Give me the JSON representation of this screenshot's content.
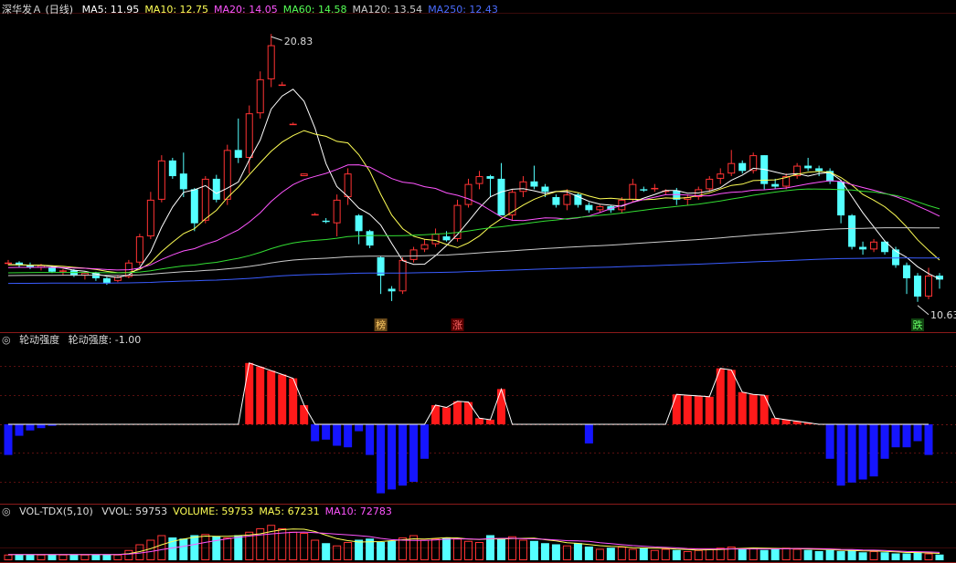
{
  "header_main": {
    "title": "深华发Ａ (日线)",
    "items": [
      {
        "label": "MA5: 11.95",
        "color": "#ffffff"
      },
      {
        "label": "MA10: 12.75",
        "color": "#ffff55"
      },
      {
        "label": "MA20: 14.05",
        "color": "#ff55ff"
      },
      {
        "label": "MA60: 14.58",
        "color": "#55ff55"
      },
      {
        "label": "MA120: 13.54",
        "color": "#cccccc"
      },
      {
        "label": "MA250: 12.43",
        "color": "#4a6cff"
      }
    ]
  },
  "header_ind": {
    "title": "轮动强度",
    "value": "轮动强度: -1.00"
  },
  "header_vol": {
    "title": "VOL-TDX(5,10)",
    "items": [
      {
        "label": "VVOL: 59753",
        "color": "#dddddd"
      },
      {
        "label": "VOLUME: 59753",
        "color": "#ffff55"
      },
      {
        "label": "MA5: 67231",
        "color": "#ffff55"
      },
      {
        "label": "MA10: 72783",
        "color": "#ff55ff"
      }
    ]
  },
  "annotations": {
    "high_label": "20.83",
    "low_label": "10.63",
    "tag_bang": "榜",
    "tag_zhang": "涨",
    "tag_die": "跌"
  },
  "colors": {
    "up": "#ff3333",
    "down": "#54ffff",
    "bar_pos": "#ff1a1a",
    "bar_neg": "#1515ff",
    "divider": "#8b1a1a"
  },
  "chart_data": [
    {
      "type": "candlestick",
      "title": "深华发Ａ (日线)",
      "y_range_estimated": [
        10.0,
        21.5
      ],
      "marked_high": 20.83,
      "marked_low": 10.63,
      "series_names": [
        "MA5",
        "MA10",
        "MA20",
        "MA60",
        "MA120",
        "MA250"
      ],
      "candles_ohlc": [
        [
          12.1,
          12.2,
          12.0,
          12.1
        ],
        [
          12.1,
          12.15,
          11.9,
          12.0
        ],
        [
          12.0,
          12.1,
          11.85,
          11.9
        ],
        [
          11.9,
          12.05,
          11.8,
          12.0
        ],
        [
          11.9,
          11.95,
          11.7,
          11.75
        ],
        [
          11.75,
          11.85,
          11.6,
          11.8
        ],
        [
          11.8,
          11.85,
          11.55,
          11.6
        ],
        [
          11.6,
          11.75,
          11.45,
          11.7
        ],
        [
          11.7,
          11.75,
          11.4,
          11.5
        ],
        [
          11.5,
          11.55,
          11.25,
          11.3
        ],
        [
          11.4,
          11.6,
          11.35,
          11.55
        ],
        [
          11.55,
          12.2,
          11.5,
          12.1
        ],
        [
          12.1,
          13.2,
          12.0,
          13.1
        ],
        [
          13.1,
          14.8,
          13.0,
          14.5
        ],
        [
          14.5,
          16.2,
          14.4,
          16.0
        ],
        [
          16.0,
          16.1,
          15.3,
          15.4
        ],
        [
          15.5,
          16.3,
          14.6,
          14.9
        ],
        [
          14.9,
          14.95,
          13.3,
          13.6
        ],
        [
          13.7,
          15.4,
          13.6,
          15.3
        ],
        [
          15.3,
          15.45,
          14.4,
          14.5
        ],
        [
          14.5,
          16.6,
          14.3,
          16.4
        ],
        [
          16.4,
          17.6,
          15.9,
          16.1
        ],
        [
          16.1,
          18.1,
          15.5,
          17.8
        ],
        [
          17.8,
          19.4,
          17.6,
          19.1
        ],
        [
          19.1,
          20.83,
          18.8,
          20.4
        ],
        [
          18.9,
          19.0,
          18.9,
          18.9
        ],
        [
          17.4,
          17.45,
          17.4,
          17.4
        ],
        [
          15.4,
          15.5,
          15.4,
          15.5
        ],
        [
          13.9,
          14.0,
          13.9,
          13.95
        ],
        [
          13.7,
          13.8,
          13.6,
          13.65
        ],
        [
          13.6,
          14.7,
          13.1,
          14.5
        ],
        [
          14.6,
          15.7,
          14.3,
          15.5
        ],
        [
          13.9,
          13.95,
          12.8,
          13.3
        ],
        [
          13.3,
          13.35,
          12.65,
          12.75
        ],
        [
          12.3,
          12.35,
          10.9,
          11.6
        ],
        [
          11.1,
          11.2,
          10.63,
          11.0
        ],
        [
          11.0,
          12.3,
          10.9,
          12.2
        ],
        [
          12.2,
          12.7,
          12.1,
          12.6
        ],
        [
          12.6,
          13.0,
          12.5,
          12.8
        ],
        [
          12.8,
          13.4,
          12.7,
          13.2
        ],
        [
          13.1,
          13.3,
          12.9,
          12.95
        ],
        [
          13.0,
          14.5,
          12.9,
          14.3
        ],
        [
          14.3,
          15.3,
          14.2,
          15.1
        ],
        [
          15.1,
          15.6,
          14.9,
          15.4
        ],
        [
          15.4,
          15.45,
          14.6,
          15.3
        ],
        [
          15.3,
          15.9,
          14.2,
          13.9
        ],
        [
          13.9,
          14.9,
          13.7,
          14.8
        ],
        [
          14.8,
          15.4,
          14.6,
          15.2
        ],
        [
          15.2,
          15.8,
          14.9,
          15.0
        ],
        [
          15.0,
          15.1,
          14.6,
          14.8
        ],
        [
          14.6,
          14.7,
          14.2,
          14.3
        ],
        [
          14.3,
          14.9,
          14.1,
          14.7
        ],
        [
          14.7,
          14.75,
          14.2,
          14.3
        ],
        [
          14.3,
          14.4,
          14.0,
          14.1
        ],
        [
          14.1,
          14.3,
          14.0,
          14.25
        ],
        [
          14.25,
          14.3,
          14.0,
          14.1
        ],
        [
          14.1,
          14.6,
          14.0,
          14.5
        ],
        [
          14.5,
          15.3,
          14.4,
          15.1
        ],
        [
          14.9,
          15.0,
          14.8,
          14.85
        ],
        [
          14.9,
          15.1,
          14.8,
          14.95
        ],
        [
          14.8,
          14.9,
          14.7,
          14.85
        ],
        [
          14.85,
          14.95,
          14.3,
          14.5
        ],
        [
          14.5,
          14.7,
          14.3,
          14.6
        ],
        [
          14.6,
          15.0,
          14.5,
          14.9
        ],
        [
          14.9,
          15.4,
          14.8,
          15.3
        ],
        [
          15.3,
          15.7,
          15.1,
          15.5
        ],
        [
          15.5,
          16.4,
          15.4,
          15.9
        ],
        [
          15.9,
          16.0,
          15.5,
          15.6
        ],
        [
          15.6,
          16.3,
          15.5,
          16.2
        ],
        [
          16.2,
          16.2,
          14.9,
          15.1
        ],
        [
          15.1,
          15.3,
          14.9,
          15.0
        ],
        [
          15.0,
          15.5,
          14.9,
          15.4
        ],
        [
          15.4,
          15.9,
          15.3,
          15.8
        ],
        [
          15.8,
          16.1,
          15.6,
          15.7
        ],
        [
          15.7,
          15.8,
          15.4,
          15.6
        ],
        [
          15.6,
          15.7,
          15.1,
          15.2
        ],
        [
          15.2,
          15.25,
          13.6,
          13.9
        ],
        [
          13.9,
          13.95,
          12.6,
          12.7
        ],
        [
          12.7,
          12.9,
          12.4,
          12.6
        ],
        [
          12.6,
          13.0,
          12.5,
          12.9
        ],
        [
          12.9,
          12.95,
          12.4,
          12.5
        ],
        [
          12.6,
          12.7,
          11.9,
          12.0
        ],
        [
          12.0,
          12.1,
          10.9,
          11.5
        ],
        [
          11.6,
          11.7,
          10.6,
          10.8
        ],
        [
          10.8,
          11.9,
          10.7,
          11.6
        ],
        [
          11.6,
          11.7,
          11.1,
          11.45
        ]
      ],
      "ma_final": {
        "MA5": 11.95,
        "MA10": 12.75,
        "MA20": 14.05,
        "MA60": 14.58,
        "MA120": 13.54,
        "MA250": 12.43
      }
    },
    {
      "type": "bar",
      "title": "轮动强度",
      "current": -1.0,
      "values": [
        -0.4,
        -0.15,
        -0.08,
        -0.05,
        -0.02,
        0,
        0,
        0,
        0,
        0,
        0,
        0,
        0,
        0,
        0,
        0,
        0,
        0,
        0,
        0,
        0,
        0,
        0.8,
        0.75,
        0.7,
        0.65,
        0.6,
        0.25,
        -0.22,
        -0.2,
        -0.28,
        -0.3,
        -0.09,
        -0.4,
        -0.9,
        -0.85,
        -0.8,
        -0.75,
        -0.45,
        0.25,
        0.22,
        0.3,
        0.29,
        0.08,
        0.06,
        0.46,
        0,
        0,
        0,
        0,
        0,
        0,
        0,
        -0.25,
        0,
        0,
        0,
        0,
        0,
        0,
        0,
        0.39,
        0.38,
        0.37,
        0.36,
        0.73,
        0.71,
        0.42,
        0.39,
        0.38,
        0.08,
        0.06,
        0.04,
        0.02,
        0,
        -0.45,
        -0.8,
        -0.76,
        -0.72,
        -0.68,
        -0.45,
        -0.3,
        -0.3,
        -0.22,
        -0.4
      ]
    },
    {
      "type": "bar",
      "title": "VOL-TDX(5,10)",
      "series_names": [
        "VVOL",
        "MA5",
        "MA10"
      ],
      "values": [
        5,
        5,
        5,
        5,
        5,
        5,
        5,
        5,
        5,
        5,
        5,
        9,
        14,
        18,
        22,
        20,
        19,
        22,
        23,
        21,
        20,
        22,
        25,
        28,
        31,
        28,
        25,
        24,
        18,
        15,
        13,
        16,
        18,
        19,
        16,
        17,
        20,
        22,
        18,
        19,
        20,
        19,
        17,
        16,
        22,
        19,
        21,
        18,
        17,
        15,
        14,
        13,
        15,
        12,
        10,
        11,
        12,
        10,
        11,
        9,
        10,
        9,
        8,
        9,
        10,
        11,
        12,
        10,
        11,
        9,
        10,
        11,
        10,
        9,
        8,
        9,
        8,
        9,
        7,
        8,
        7,
        6,
        6,
        7,
        6,
        5
      ],
      "final": {
        "VVOL": 59753,
        "VOLUME": 59753,
        "MA5": 67231,
        "MA10": 72783
      }
    }
  ]
}
